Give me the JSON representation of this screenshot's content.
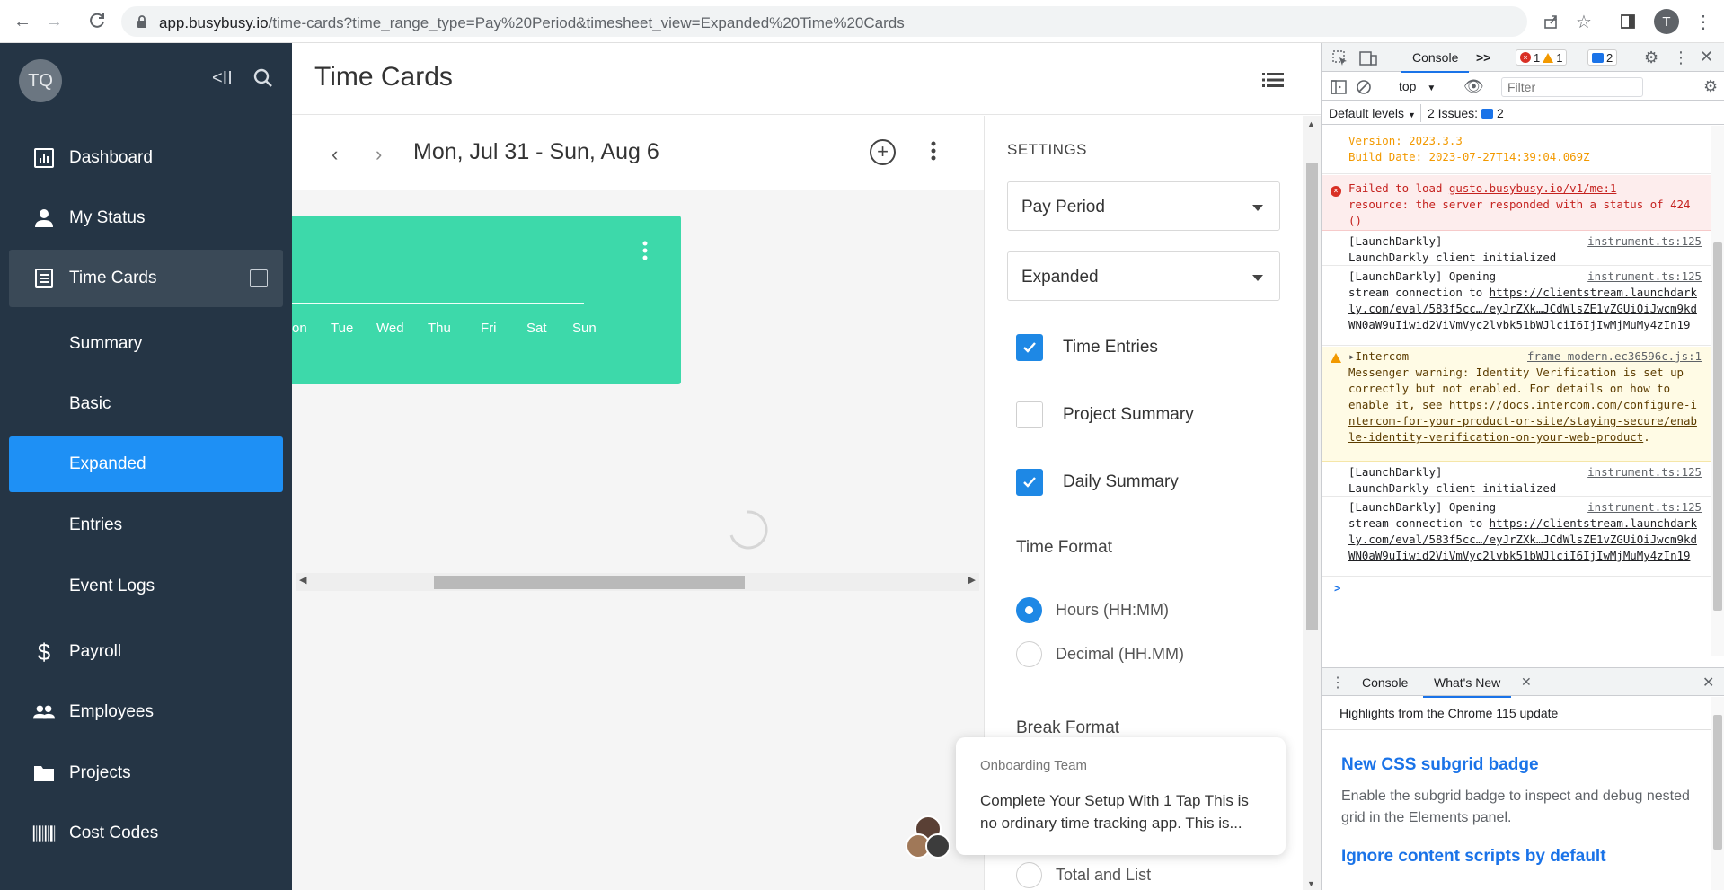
{
  "browser": {
    "url_host": "app.busybusy.io",
    "url_path": "/time-cards?time_range_type=Pay%20Period&timesheet_view=Expanded%20Time%20Cards",
    "profile_initial": "T"
  },
  "sidebar": {
    "avatar_initials": "TQ",
    "collapse_label": "<II",
    "items": [
      {
        "label": "Dashboard",
        "icon": "dashboard-icon"
      },
      {
        "label": "My Status",
        "icon": "person-icon"
      },
      {
        "label": "Time Cards",
        "icon": "timecard-icon"
      },
      {
        "label": "Summary"
      },
      {
        "label": "Basic"
      },
      {
        "label": "Expanded"
      },
      {
        "label": "Entries"
      },
      {
        "label": "Event Logs"
      },
      {
        "label": "Payroll",
        "icon": "dollar-icon"
      },
      {
        "label": "Employees",
        "icon": "people-icon"
      },
      {
        "label": "Projects",
        "icon": "folder-icon"
      },
      {
        "label": "Cost Codes",
        "icon": "barcode-icon"
      }
    ]
  },
  "main": {
    "title": "Time Cards",
    "week_range": "Mon, Jul 31 - Sun, Aug 6",
    "card_days": [
      "on",
      "Tue",
      "Wed",
      "Thu",
      "Fri",
      "Sat",
      "Sun"
    ],
    "accent": "#3dd9aa"
  },
  "settings": {
    "title": "SETTINGS",
    "range_select": "Pay Period",
    "view_select": "Expanded",
    "checks": [
      {
        "label": "Time Entries",
        "checked": true
      },
      {
        "label": "Project Summary",
        "checked": false
      },
      {
        "label": "Daily Summary",
        "checked": true
      }
    ],
    "time_format_title": "Time Format",
    "time_formats": [
      {
        "label": "Hours (HH:MM)",
        "selected": true
      },
      {
        "label": "Decimal (HH.MM)",
        "selected": false
      }
    ],
    "break_format_title": "Break Format",
    "break_partial": "Total and List"
  },
  "onboarding": {
    "from": "Onboarding Team",
    "message": "Complete Your Setup With 1 Tap This is no ordinary time tracking app. This is..."
  },
  "devtools": {
    "tabs": [
      "Console",
      ">>"
    ],
    "error_count": "1",
    "warning_count": "1",
    "message_count": "2",
    "context": "top",
    "filter_placeholder": "Filter",
    "default_levels": "Default levels",
    "issues_label": "2 Issues:",
    "issues_count": "2",
    "version_line": "Version: 2023.3.3",
    "build_line": "Build Date: 2023-07-27T14:39:04.069Z",
    "error_text_1": "Failed to load",
    "error_link": "gusto.busybusy.io/v1/me:1",
    "error_text_2": "resource: the server responded with a status of 424 ()",
    "ld1_head": "[LaunchDarkly]",
    "ld1_src": "instrument.ts:125",
    "ld1_body": "LaunchDarkly client initialized",
    "ld2_head": "[LaunchDarkly] Opening",
    "ld2_src": "instrument.ts:125",
    "ld2_body_1": "stream connection to",
    "ld2_link": "https://clientstream.launchdarkly.com/eval/583f5cc…/eyJrZXk…JCdWlsZE1vZGUiOiJwcm9kdWN0aW9uIiwid2ViVmVyc2lvbk51bWJlciI6IjIwMjMuMy4zIn19",
    "warn_head": "Intercom",
    "warn_src": "frame-modern.ec36596c.js:1",
    "warn_body": "Messenger warning: Identity Verification is set up correctly but not enabled. For details on how to enable it, see",
    "warn_link": "https://docs.intercom.com/configure-intercom-for-your-product-or-site/staying-secure/enable-identity-verification-on-your-web-product",
    "ld3_head": "[LaunchDarkly]",
    "ld3_src": "instrument.ts:125",
    "ld3_body": "LaunchDarkly client initialized",
    "ld4_head": "[LaunchDarkly] Opening",
    "ld4_src": "instrument.ts:125",
    "ld4_body_1": "stream connection to",
    "ld4_link": "https://clientstream.launchdarkly.com/eval/583f5cc…/eyJrZXk…JCdWlsZE1vZGUiOiJwcm9kdWN0aW9uIiwid2ViVmVyc2lvbk51bWJlciI6IjIwMjMuMy4zIn19",
    "prompt": ">",
    "drawer_tabs": [
      "Console",
      "What's New"
    ],
    "whats_new_sub": "Highlights from the Chrome 115 update",
    "wn1_title": "New CSS subgrid badge",
    "wn1_text": "Enable the subgrid badge to inspect and debug nested grid in the Elements panel.",
    "wn2_title": "Ignore content scripts by default"
  }
}
